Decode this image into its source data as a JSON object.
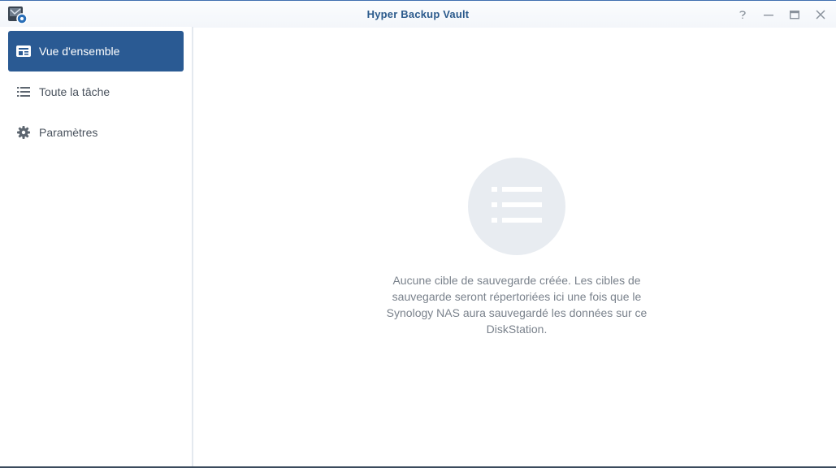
{
  "window": {
    "title": "Hyper Backup Vault",
    "controls": [
      "help-icon",
      "minimize-icon",
      "maximize-icon",
      "close-icon"
    ]
  },
  "sidebar": {
    "items": [
      {
        "label": "Vue d'ensemble",
        "icon": "overview-card-icon",
        "active": true
      },
      {
        "label": "Toute la tâche",
        "icon": "list-icon",
        "active": false
      },
      {
        "label": "Paramètres",
        "icon": "gear-icon",
        "active": false
      }
    ]
  },
  "main": {
    "empty_state": {
      "icon": "list-icon",
      "message": "Aucune cible de sauvegarde créée. Les cibles de sauvegarde seront répertoriées ici une fois que le Synology NAS aura sauvegardé les données sur ce DiskStation."
    }
  },
  "colors": {
    "accent": "#2a5a93",
    "title": "#2b5a8c",
    "empty_circle": "#e8ecf1"
  }
}
